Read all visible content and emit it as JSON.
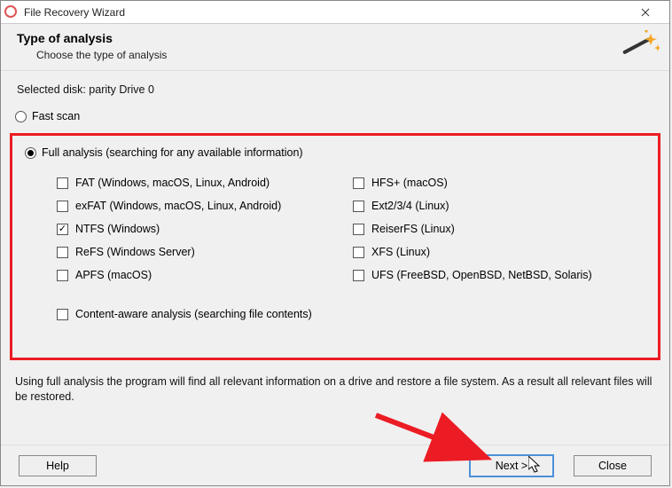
{
  "window": {
    "title": "File Recovery Wizard"
  },
  "header": {
    "title": "Type of analysis",
    "subtitle": "Choose the type of analysis"
  },
  "selected_label": "Selected disk: parity Drive 0",
  "scan": {
    "fast_label": "Fast scan",
    "full_label": "Full analysis (searching for any available information)"
  },
  "fs": {
    "left": [
      {
        "label": "FAT (Windows, macOS, Linux, Android)",
        "checked": false
      },
      {
        "label": "exFAT (Windows, macOS, Linux, Android)",
        "checked": false
      },
      {
        "label": "NTFS (Windows)",
        "checked": true
      },
      {
        "label": "ReFS (Windows Server)",
        "checked": false
      },
      {
        "label": "APFS (macOS)",
        "checked": false
      }
    ],
    "right": [
      {
        "label": "HFS+ (macOS)",
        "checked": false
      },
      {
        "label": "Ext2/3/4 (Linux)",
        "checked": false
      },
      {
        "label": "ReiserFS (Linux)",
        "checked": false
      },
      {
        "label": "XFS (Linux)",
        "checked": false
      },
      {
        "label": "UFS (FreeBSD, OpenBSD, NetBSD, Solaris)",
        "checked": false
      }
    ]
  },
  "content_aware_label": "Content-aware analysis (searching file contents)",
  "description": "Using full analysis the program will find all relevant information on a drive and restore a file system. As a result all relevant files will be restored.",
  "buttons": {
    "help": "Help",
    "next": "Next >",
    "close": "Close"
  }
}
